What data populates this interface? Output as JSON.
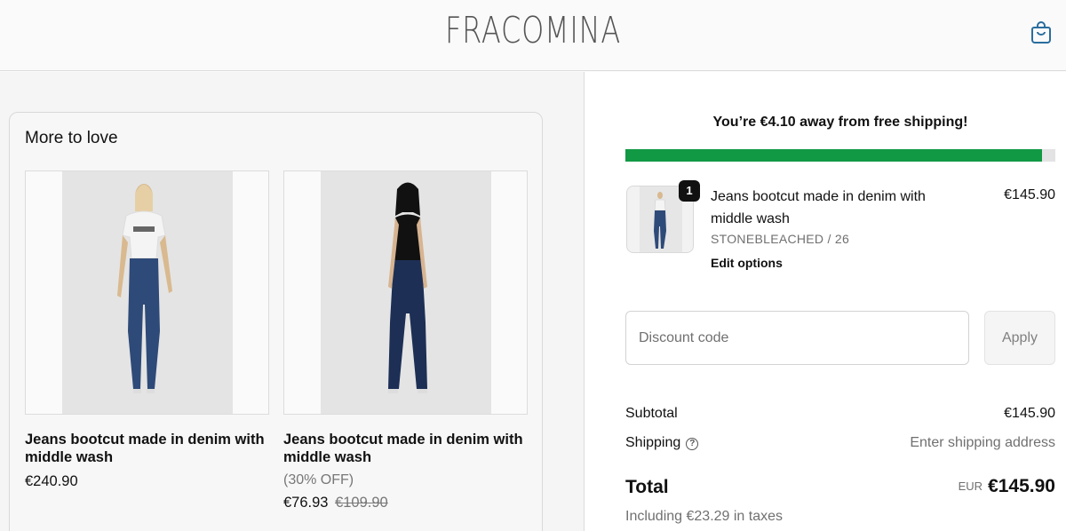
{
  "header": {
    "logo": "FRACOMINA",
    "icon": "shopping-bag-icon"
  },
  "upsell": {
    "title": "More to love",
    "products": [
      {
        "name": "Jeans bootcut made in denim with middle wash",
        "price": "€240.90"
      },
      {
        "name": "Jeans bootcut made in denim with middle wash",
        "discount": "(30% OFF)",
        "price": "€76.93",
        "compare_price": "€109.90"
      }
    ]
  },
  "cart": {
    "free_shipping_message": "You’re €4.10 away from free shipping!",
    "free_shipping_progress": 0.97,
    "progress_color": "#119944",
    "item": {
      "quantity": "1",
      "name": "Jeans bootcut made in denim with middle wash",
      "variant": "STONEBLEACHED / 26",
      "price": "€145.90",
      "edit_label": "Edit options"
    },
    "discount": {
      "placeholder": "Discount code",
      "apply_label": "Apply"
    },
    "summary": {
      "subtotal_label": "Subtotal",
      "subtotal_value": "€145.90",
      "shipping_label": "Shipping",
      "shipping_value": "Enter shipping address",
      "total_label": "Total",
      "currency": "EUR",
      "total_value": "€145.90",
      "taxes_note": "Including €23.29 in taxes"
    }
  }
}
